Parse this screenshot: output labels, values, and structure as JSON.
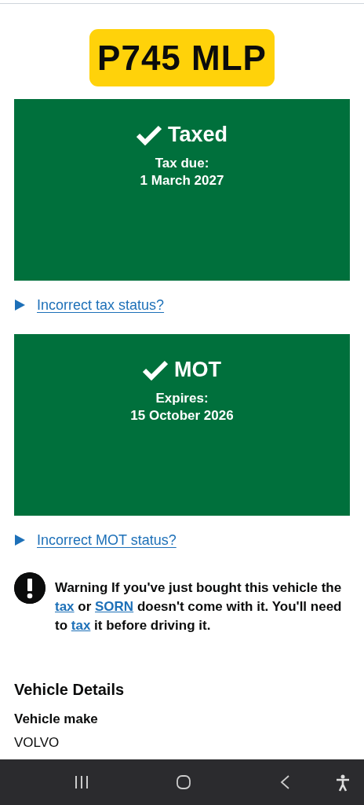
{
  "registration": "P745 MLP",
  "statuses": [
    {
      "title": "Taxed",
      "label": "Tax due:",
      "date": "1 March 2027",
      "link": {
        "text": "Incorrect tax status?",
        "expanded": false
      }
    },
    {
      "title": "MOT",
      "label": "Expires:",
      "date": "15 October 2026",
      "link": {
        "text": "Incorrect MOT status?",
        "expanded": false
      }
    }
  ],
  "warning": {
    "parts": [
      {
        "kind": "text",
        "text": "Warning If you've just bought this vehicle the "
      },
      {
        "kind": "link",
        "text": "tax"
      },
      {
        "kind": "text",
        "text": " or "
      },
      {
        "kind": "link",
        "text": "SORN"
      },
      {
        "kind": "text",
        "text": " doesn't come with it. You'll need to "
      },
      {
        "kind": "link",
        "text": "tax"
      },
      {
        "kind": "text",
        "text": " it before driving it."
      }
    ]
  },
  "vehicle_details": {
    "heading": "Vehicle Details",
    "rows": [
      {
        "key": "Vehicle make",
        "value": "VOLVO"
      }
    ]
  }
}
